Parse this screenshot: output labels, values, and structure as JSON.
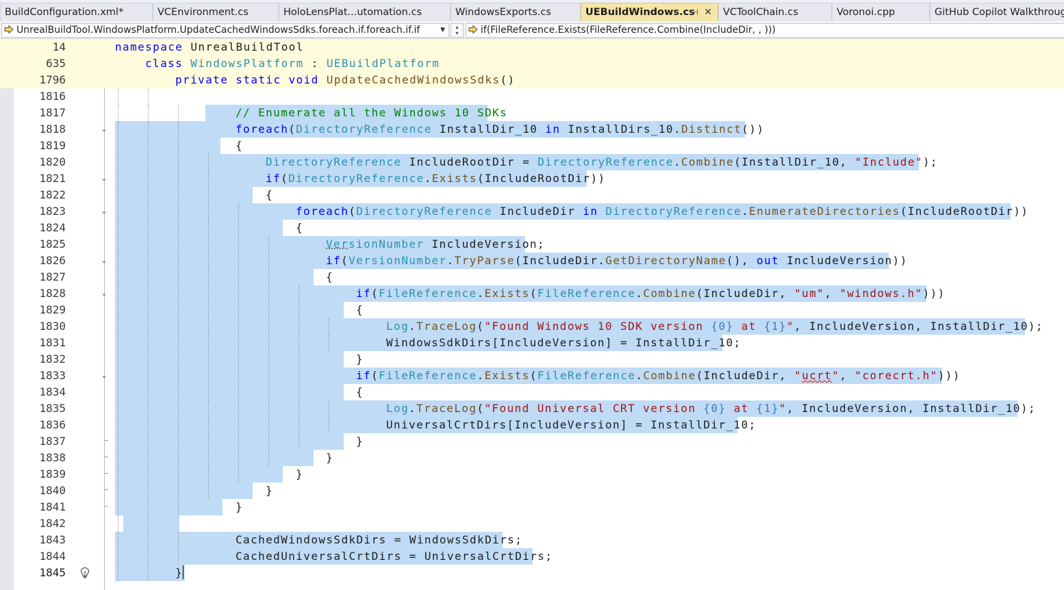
{
  "tabs": [
    {
      "label": "BuildConfiguration.xml*",
      "active": false
    },
    {
      "label": "VCEnvironment.cs",
      "active": false
    },
    {
      "label": "HoloLensPlat...utomation.cs",
      "active": false
    },
    {
      "label": "WindowsExports.cs",
      "active": false
    },
    {
      "label": "UEBuildWindows.cs",
      "active": true
    },
    {
      "label": "VCToolChain.cs",
      "active": false
    },
    {
      "label": "Voronoi.cpp",
      "active": false
    },
    {
      "label": "GitHub Copilot Walkthrough",
      "active": false
    }
  ],
  "navigation": {
    "scope": "UnrealBuildTool.WindowsPlatform.UpdateCachedWindowsSdks.foreach.if.foreach.if.if",
    "member": "if(FileReference.Exists(FileReference.Combine(IncludeDir, , )))"
  },
  "sticky_scroll": [
    {
      "line": "14",
      "text": "namespace UnrealBuildTool"
    },
    {
      "line": "635",
      "text": "class WindowsPlatform : UEBuildPlatform"
    },
    {
      "line": "1796",
      "text": "private static void UpdateCachedWindowsSdks()"
    }
  ],
  "code_lines": [
    {
      "line": "1816",
      "text": ""
    },
    {
      "line": "1817",
      "text": "// Enumerate all the Windows 10 SDKs"
    },
    {
      "line": "1818",
      "text": "foreach(DirectoryReference InstallDir_10 in InstallDirs_10.Distinct())"
    },
    {
      "line": "1819",
      "text": "{"
    },
    {
      "line": "1820",
      "text": "DirectoryReference IncludeRootDir = DirectoryReference.Combine(InstallDir_10, \"Include\");"
    },
    {
      "line": "1821",
      "text": "if(DirectoryReference.Exists(IncludeRootDir))"
    },
    {
      "line": "1822",
      "text": "{"
    },
    {
      "line": "1823",
      "text": "foreach(DirectoryReference IncludeDir in DirectoryReference.EnumerateDirectories(IncludeRootDir))"
    },
    {
      "line": "1824",
      "text": "{"
    },
    {
      "line": "1825",
      "text": "VersionNumber IncludeVersion;"
    },
    {
      "line": "1826",
      "text": "if(VersionNumber.TryParse(IncludeDir.GetDirectoryName(), out IncludeVersion))"
    },
    {
      "line": "1827",
      "text": "{"
    },
    {
      "line": "1828",
      "text": "if(FileReference.Exists(FileReference.Combine(IncludeDir, \"um\", \"windows.h\")))"
    },
    {
      "line": "1829",
      "text": "{"
    },
    {
      "line": "1830",
      "text": "Log.TraceLog(\"Found Windows 10 SDK version {0} at {1}\", IncludeVersion, InstallDir_10);"
    },
    {
      "line": "1831",
      "text": "WindowsSdkDirs[IncludeVersion] = InstallDir_10;"
    },
    {
      "line": "1832",
      "text": "}"
    },
    {
      "line": "1833",
      "text": "if(FileReference.Exists(FileReference.Combine(IncludeDir, \"ucrt\", \"corecrt.h\")))"
    },
    {
      "line": "1834",
      "text": "{"
    },
    {
      "line": "1835",
      "text": "Log.TraceLog(\"Found Universal CRT version {0} at {1}\", IncludeVersion, InstallDir_10);"
    },
    {
      "line": "1836",
      "text": "UniversalCrtDirs[IncludeVersion] = InstallDir_10;"
    },
    {
      "line": "1837",
      "text": "}"
    },
    {
      "line": "1838",
      "text": "}"
    },
    {
      "line": "1839",
      "text": "}"
    },
    {
      "line": "1840",
      "text": "}"
    },
    {
      "line": "1841",
      "text": "}"
    },
    {
      "line": "1842",
      "text": ""
    },
    {
      "line": "1843",
      "text": "CachedWindowsSdkDirs = WindowsSdkDirs;"
    },
    {
      "line": "1844",
      "text": "CachedUniversalCrtDirs = UniversalCrtDirs;"
    },
    {
      "line": "1845",
      "text": "}"
    }
  ],
  "icons": {
    "tab_pin": "pin-icon",
    "tab_close": "close-icon",
    "nav_scope": "navigate-arrow-icon",
    "quick_action": "lightbulb-icon"
  },
  "colors": {
    "keyword": "#0000ff",
    "type": "#2b91af",
    "method": "#74531f",
    "string": "#a31515",
    "comment": "#008000",
    "selection": "#bfdbf6",
    "sticky_background": "#fffbdd",
    "active_tab": "#f5e6a8"
  }
}
